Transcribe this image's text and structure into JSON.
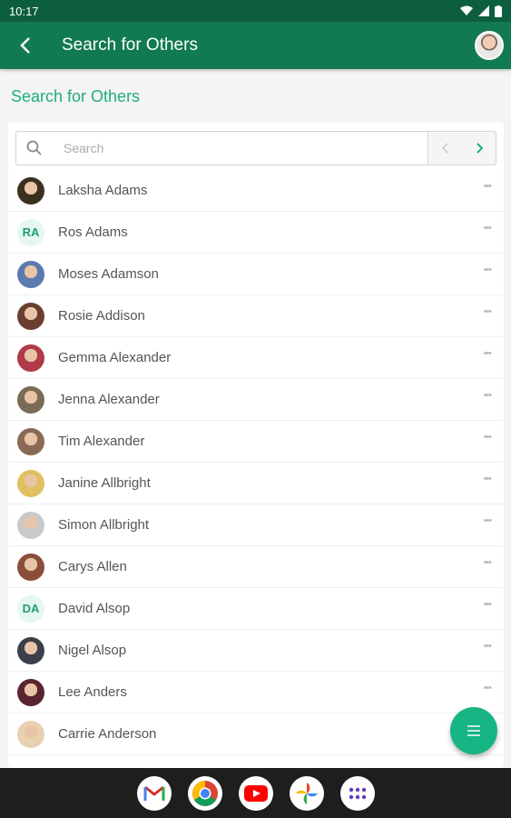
{
  "status": {
    "time": "10:17"
  },
  "header": {
    "title": "Search for Others",
    "back_icon": "arrow-back-icon",
    "avatar_icon": "user-avatar"
  },
  "page": {
    "heading": "Search for Others"
  },
  "search": {
    "placeholder": "Search",
    "value": ""
  },
  "people": [
    {
      "name": "Laksha Adams",
      "initials": "",
      "color": "#3a3020"
    },
    {
      "name": "Ros Adams",
      "initials": "RA",
      "color": ""
    },
    {
      "name": "Moses Adamson",
      "initials": "",
      "color": "#5a7ab0"
    },
    {
      "name": "Rosie Addison",
      "initials": "",
      "color": "#6a3f30"
    },
    {
      "name": "Gemma Alexander",
      "initials": "",
      "color": "#b03a48"
    },
    {
      "name": "Jenna Alexander",
      "initials": "",
      "color": "#7a6b55"
    },
    {
      "name": "Tim Alexander",
      "initials": "",
      "color": "#8a6a55"
    },
    {
      "name": "Janine Allbright",
      "initials": "",
      "color": "#e0c060"
    },
    {
      "name": "Simon Allbright",
      "initials": "",
      "color": "#c9c9c9"
    },
    {
      "name": "Carys Allen",
      "initials": "",
      "color": "#8a4e3a"
    },
    {
      "name": "David Alsop",
      "initials": "DA",
      "color": ""
    },
    {
      "name": "Nigel Alsop",
      "initials": "",
      "color": "#3a3f4a"
    },
    {
      "name": "Lee Anders",
      "initials": "",
      "color": "#5a2530"
    },
    {
      "name": "Carrie Anderson",
      "initials": "",
      "color": "#e8d0b0"
    }
  ],
  "colors": {
    "primary": "#127a51",
    "status_bar": "#0d5e3f",
    "accent": "#1fae78",
    "fab": "#16b583"
  },
  "fab_icon": "menu-icon",
  "dock": [
    "gmail-icon",
    "chrome-icon",
    "youtube-icon",
    "photos-icon",
    "apps-icon"
  ]
}
